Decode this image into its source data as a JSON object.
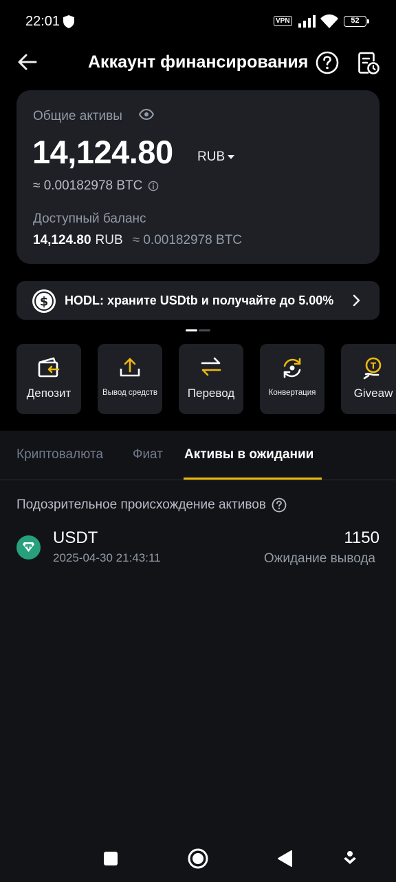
{
  "status_bar": {
    "time": "22:01",
    "vpn_label": "VPN",
    "battery": "52",
    "icons": [
      "shield-icon",
      "signal-icon",
      "wifi-icon",
      "battery-icon"
    ]
  },
  "header": {
    "title": "Аккаунт финансирования",
    "icons": [
      "back-arrow-icon",
      "help-circle-icon",
      "history-icon"
    ]
  },
  "balance_card": {
    "total_label": "Общие активы",
    "total_value": "14,124.80",
    "currency": "RUB",
    "btc_equivalent": "≈ 0.00182978 BTC",
    "available_label": "Доступный баланс",
    "available_amount": "14,124.80",
    "available_currency": "RUB",
    "available_btc": "≈ 0.00182978 BTC"
  },
  "banner": {
    "text": "HODL: храните USDtb и получайте до 5.00%",
    "icon": "dollar-coin-icon"
  },
  "actions": [
    {
      "label": "Депозит",
      "icon": "deposit-icon"
    },
    {
      "label": "Вывод средств",
      "icon": "upload-icon"
    },
    {
      "label": "Перевод",
      "icon": "transfer-icon"
    },
    {
      "label": "Конвертация",
      "icon": "convert-icon"
    },
    {
      "label": "Giveaw",
      "icon": "giveaway-icon"
    }
  ],
  "tabs": [
    {
      "label": "Криптовалюта",
      "active": false
    },
    {
      "label": "Фиат",
      "active": false
    },
    {
      "label": "Активы в ожидании",
      "active": true
    }
  ],
  "section": {
    "title": "Подозрительное происхождение активов"
  },
  "assets": [
    {
      "name": "USDT",
      "date": "2025-04-30 21:43:11",
      "amount": "1150",
      "status": "Ожидание вывода"
    }
  ],
  "colors": {
    "accent": "#f0b90b",
    "background": "#000000",
    "card": "#1e2026",
    "tether": "#26a17b"
  }
}
